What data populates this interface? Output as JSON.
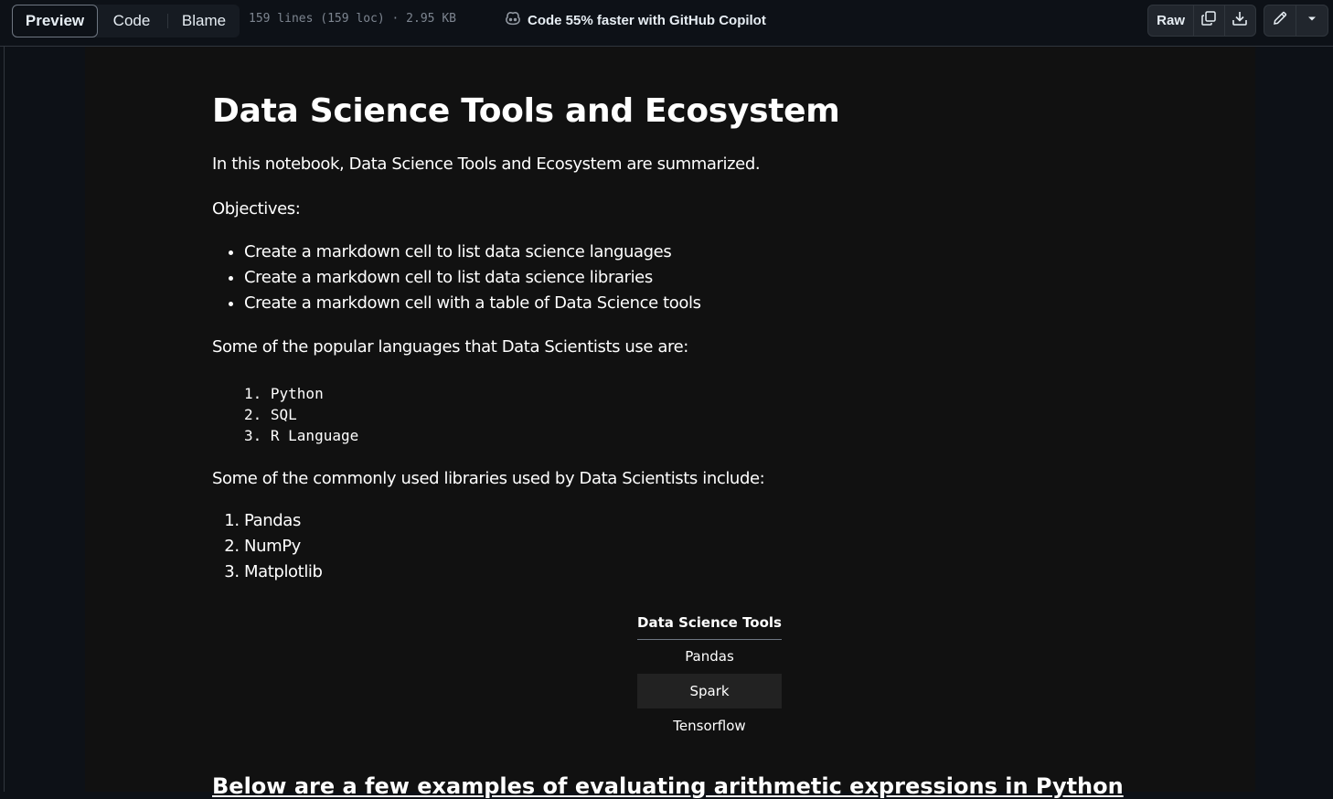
{
  "toolbar": {
    "tabs": [
      {
        "label": "Preview",
        "active": true
      },
      {
        "label": "Code",
        "active": false
      },
      {
        "label": "Blame",
        "active": false
      }
    ],
    "file_meta": "159 lines (159 loc) · 2.95 KB",
    "copilot_text": "Code 55% faster with GitHub Copilot",
    "copilot_icon": "copilot-icon",
    "raw_label": "Raw",
    "icons": [
      "copy-icon",
      "download-icon",
      "pencil-icon",
      "triangle-down-icon"
    ]
  },
  "notebook": {
    "title": "Data Science Tools and Ecosystem",
    "intro": "In this notebook, Data Science Tools and Ecosystem are summarized.",
    "objectives_label": "Objectives:",
    "objectives": [
      "Create a markdown cell to list data science languages",
      "Create a markdown cell to list data science libraries",
      "Create a markdown cell with a table of Data Science tools"
    ],
    "languages_intro": "Some of the popular languages that Data Scientists use are:",
    "languages_code": [
      "1. Python",
      "2. SQL",
      "3. R Language"
    ],
    "libraries_intro": "Some of the commonly used libraries used by Data Scientists include:",
    "libraries": [
      "Pandas",
      "NumPy",
      "Matplotlib"
    ],
    "tools_table": {
      "header": "Data Science Tools",
      "rows": [
        "Pandas",
        "Spark",
        "Tensorflow"
      ]
    },
    "next_heading": "Below are a few examples of evaluating arithmetic expressions in Python"
  },
  "colors": {
    "page_bg": "#0d1117",
    "notebook_bg": "#111111",
    "text": "#ffffff",
    "muted": "#7d8590",
    "border": "#30363d"
  }
}
